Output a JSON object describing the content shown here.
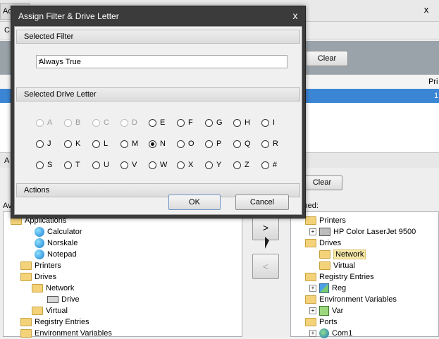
{
  "background": {
    "tab_label": "Ac",
    "close_glyph": "x",
    "toolbar_label": "C",
    "clear_label": "Clear",
    "grid_header_right": "Pri",
    "selected_row_value": "1",
    "section_label": "A",
    "available_label": "Av",
    "assigned_label": "igned:",
    "move_right_label": ">",
    "move_left_label": "<",
    "left_tree": [
      {
        "label": "Applications",
        "type": "folder"
      },
      {
        "label": "Calculator",
        "type": "app"
      },
      {
        "label": "Norskale",
        "type": "app"
      },
      {
        "label": "Notepad",
        "type": "app"
      },
      {
        "label": "Printers",
        "type": "folder"
      },
      {
        "label": "Drives",
        "type": "folder"
      },
      {
        "label": "Network",
        "type": "folder"
      },
      {
        "label": "Drive",
        "type": "drive"
      },
      {
        "label": "Virtual",
        "type": "folder"
      },
      {
        "label": "Registry Entries",
        "type": "folder"
      },
      {
        "label": "Environment Variables",
        "type": "folder"
      }
    ],
    "right_tree": [
      {
        "label": "Printers",
        "type": "folder"
      },
      {
        "label": "HP Color LaserJet 9500",
        "type": "printer"
      },
      {
        "label": "Drives",
        "type": "folder"
      },
      {
        "label": "Network",
        "type": "folder"
      },
      {
        "label": "Virtual",
        "type": "folder"
      },
      {
        "label": "Registry Entries",
        "type": "folder"
      },
      {
        "label": "Reg",
        "type": "reg"
      },
      {
        "label": "Environment Variables",
        "type": "folder"
      },
      {
        "label": "Var",
        "type": "var"
      },
      {
        "label": "Ports",
        "type": "folder"
      },
      {
        "label": "Com1",
        "type": "com"
      }
    ]
  },
  "dialog": {
    "title": "Assign Filter & Drive Letter",
    "close_glyph": "x",
    "filter_section": "Selected Filter",
    "filter_value": "Always True",
    "dropdown_glyph": "▾",
    "drive_section": "Selected Drive Letter",
    "selected_letter": "N",
    "letters": [
      "A",
      "B",
      "C",
      "D",
      "E",
      "F",
      "G",
      "H",
      "I",
      "J",
      "K",
      "L",
      "M",
      "N",
      "O",
      "P",
      "Q",
      "R",
      "S",
      "T",
      "U",
      "V",
      "W",
      "X",
      "Y",
      "Z",
      "#"
    ],
    "disabled_letters": [
      "A",
      "B",
      "C",
      "D"
    ],
    "actions_section": "Actions",
    "ok_label": "OK",
    "cancel_label": "Cancel"
  }
}
